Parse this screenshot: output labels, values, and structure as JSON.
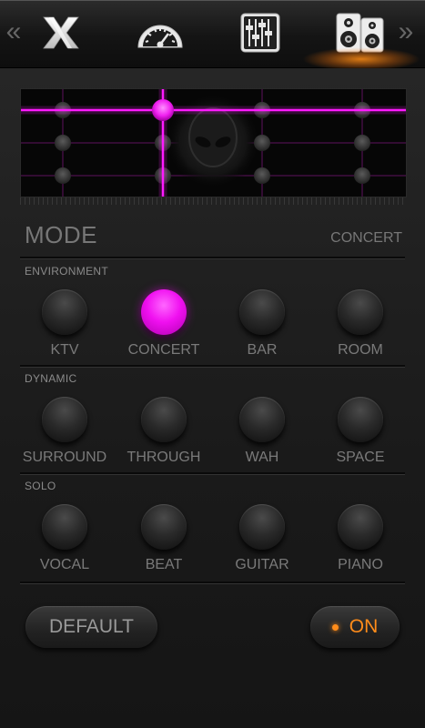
{
  "colors": {
    "accent_magenta": "#f010f0",
    "accent_orange": "#ff8c1a",
    "background": "#1b1b1b"
  },
  "nav": {
    "prev_arrow": "«",
    "next_arrow": "»",
    "tabs": [
      {
        "icon": "x-logo-icon"
      },
      {
        "icon": "speedometer-icon"
      },
      {
        "icon": "equalizer-icon"
      },
      {
        "icon": "speakers-icon",
        "selected": true
      }
    ]
  },
  "pad": {
    "icon": "alien-icon",
    "selected_point": {
      "column": 2,
      "row": 1
    }
  },
  "mode": {
    "title": "MODE",
    "value": "CONCERT"
  },
  "sections": [
    {
      "label": "ENVIRONMENT",
      "items": [
        {
          "label": "KTV",
          "active": false
        },
        {
          "label": "CONCERT",
          "active": true
        },
        {
          "label": "BAR",
          "active": false
        },
        {
          "label": "ROOM",
          "active": false
        }
      ]
    },
    {
      "label": "DYNAMIC",
      "items": [
        {
          "label": "SURROUND",
          "active": false
        },
        {
          "label": "THROUGH",
          "active": false
        },
        {
          "label": "WAH",
          "active": false
        },
        {
          "label": "SPACE",
          "active": false
        }
      ]
    },
    {
      "label": "SOLO",
      "items": [
        {
          "label": "VOCAL",
          "active": false
        },
        {
          "label": "BEAT",
          "active": false
        },
        {
          "label": "GUITAR",
          "active": false
        },
        {
          "label": "PIANO",
          "active": false
        }
      ]
    }
  ],
  "buttons": {
    "default_label": "DEFAULT",
    "on_label": "ON"
  }
}
